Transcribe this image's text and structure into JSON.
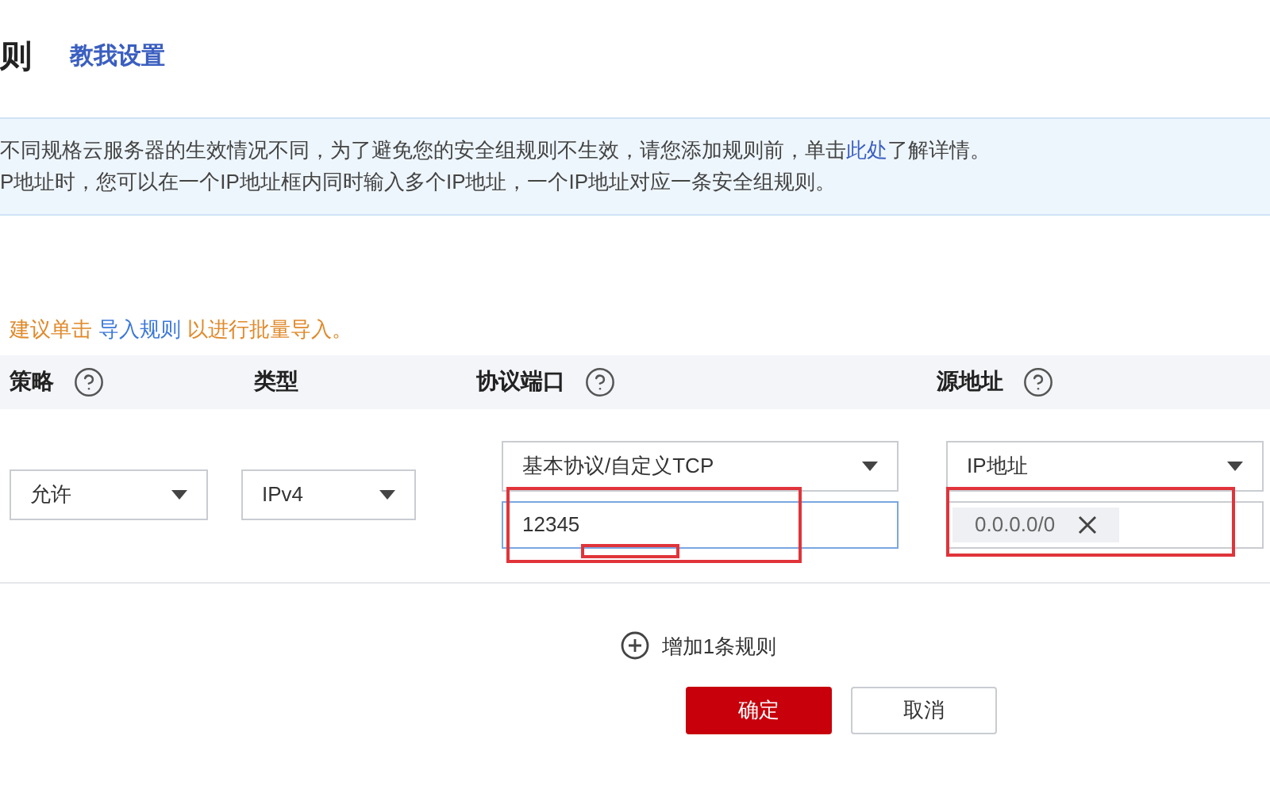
{
  "header": {
    "title": "则",
    "help_link": "教我设置"
  },
  "notice": {
    "lines": [
      {
        "text": "不同规格云服务器的生效情况不同，为了避免您的安全组规则不生效，请您添加规则前，单击",
        "link": "此处",
        "after": "了解详情。"
      },
      {
        "text": "P地址时，您可以在一个IP地址框内同时输入多个IP地址，一个IP地址对应一条安全组规则。"
      }
    ]
  },
  "import_hint": {
    "before": "建议单击",
    "link": "导入规则",
    "after": "以进行批量导入。"
  },
  "table": {
    "columns": [
      {
        "label": "策略",
        "help": true
      },
      {
        "label": "类型",
        "help": false
      },
      {
        "label": "协议端口",
        "help": true
      },
      {
        "label": "源地址",
        "help": true
      }
    ],
    "row": {
      "policy": "允许",
      "type": "IPv4",
      "protocol": "基本协议/自定义TCP",
      "port": "12345",
      "source_type": "IP地址",
      "source_tag": "0.0.0.0/0"
    }
  },
  "add_rule": "增加1条规则",
  "buttons": [
    {
      "label": "确定",
      "kind": "primary"
    },
    {
      "label": "取消",
      "kind": "secondary"
    }
  ]
}
